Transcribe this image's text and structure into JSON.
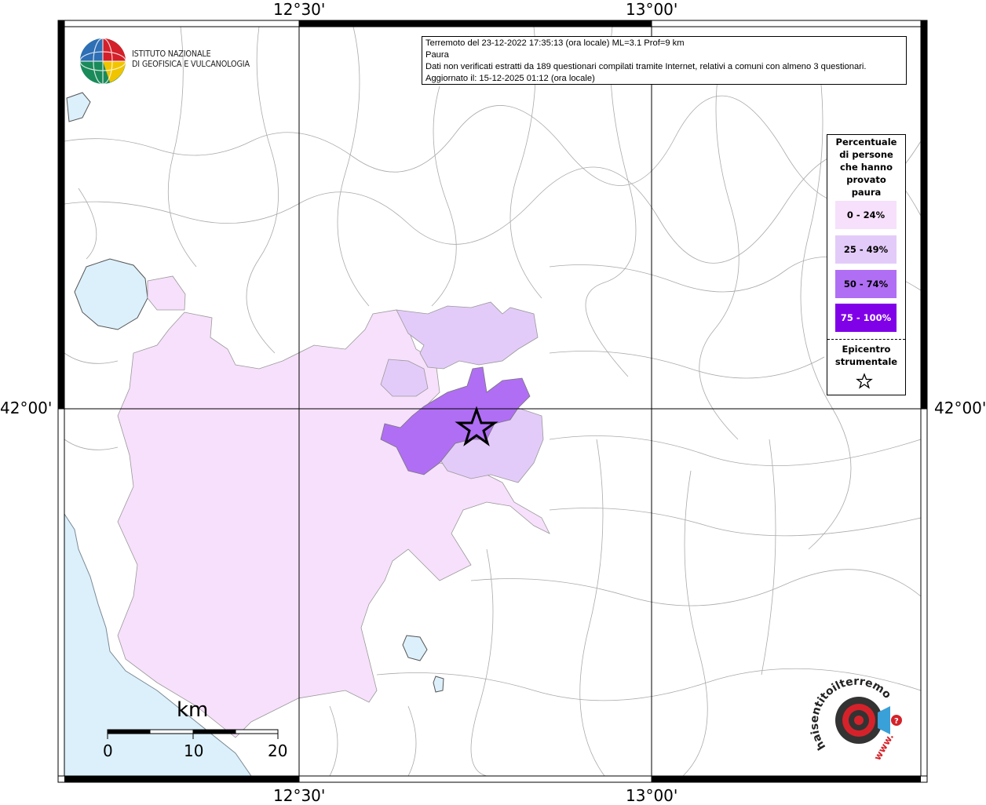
{
  "coords": {
    "top": [
      "12°30'",
      "13°00'"
    ],
    "bottom": [
      "12°30'",
      "13°00'"
    ],
    "left": "42°00'",
    "right": "42°00'"
  },
  "institute": {
    "line1": "ISTITUTO NAZIONALE",
    "line2": "DI GEOFISICA E VULCANOLOGIA"
  },
  "info": {
    "line1": "Terremoto del 23-12-2022 17:35:13 (ora locale) ML=3.1 Prof=9 km",
    "line2": "Paura",
    "line3": "Dati non verificati estratti da 189 questionari compilati tramite Internet, relativi a comuni con almeno 3 questionari.",
    "line4": "Aggiornato il: 15-12-2025 01:12 (ora locale)"
  },
  "legend": {
    "title": [
      "Percentuale",
      "di persone",
      "che hanno",
      "provato",
      "paura"
    ],
    "classes": [
      {
        "label": "0 - 24%",
        "color": "#f7e0fb",
        "text_color": "#000000"
      },
      {
        "label": "25 - 49%",
        "color": "#e3cbf9",
        "text_color": "#000000"
      },
      {
        "label": "50 - 74%",
        "color": "#b06ef4",
        "text_color": "#000000"
      },
      {
        "label": "75 - 100%",
        "color": "#8000e8",
        "text_color": "#ffffff"
      }
    ],
    "epicenter_title": [
      "Epicentro",
      "strumentale"
    ],
    "epicenter_icon": "star-outline-icon"
  },
  "scale": {
    "unit": "km",
    "ticks": [
      "0",
      "10",
      "20"
    ]
  },
  "logo_hst": {
    "text": "haisentitoilterremoto.it",
    "prefix": "www."
  },
  "colors": {
    "water": "#dcf0fb",
    "border_lines": "#888888"
  }
}
